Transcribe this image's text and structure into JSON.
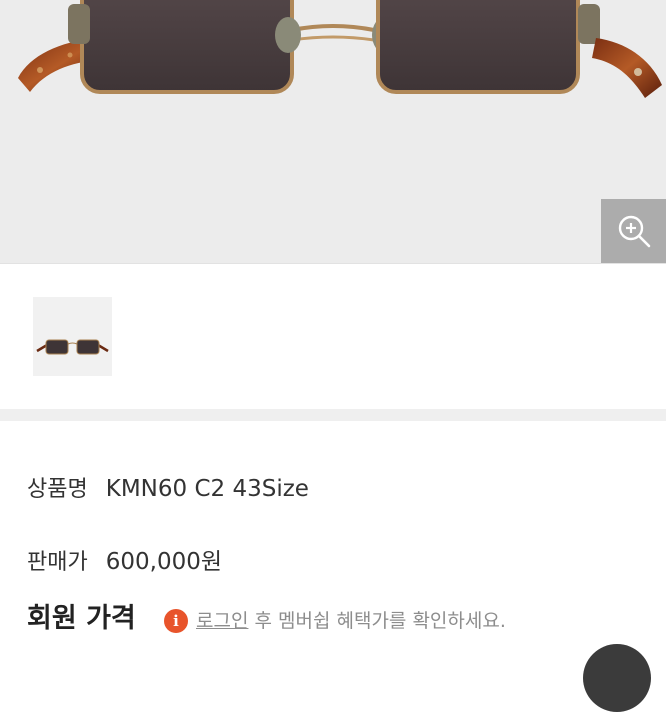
{
  "product": {
    "name_label": "상품명",
    "name_value": "KMN60 C2 43Size",
    "price_label": "판매가",
    "price_value": "600,000원"
  },
  "member_price": {
    "title": "회원 가격",
    "info_icon_char": "i",
    "login_link": "로그인",
    "note_rest": " 후 멤버쉽 혜택가를 확인하세요."
  },
  "icons": {
    "zoom": "zoom-in-icon",
    "info": "info-icon",
    "chat": "chat-icon"
  },
  "colors": {
    "info_icon": "#e8542b",
    "hero_bg": "#ececec",
    "divider": "#efefef"
  }
}
